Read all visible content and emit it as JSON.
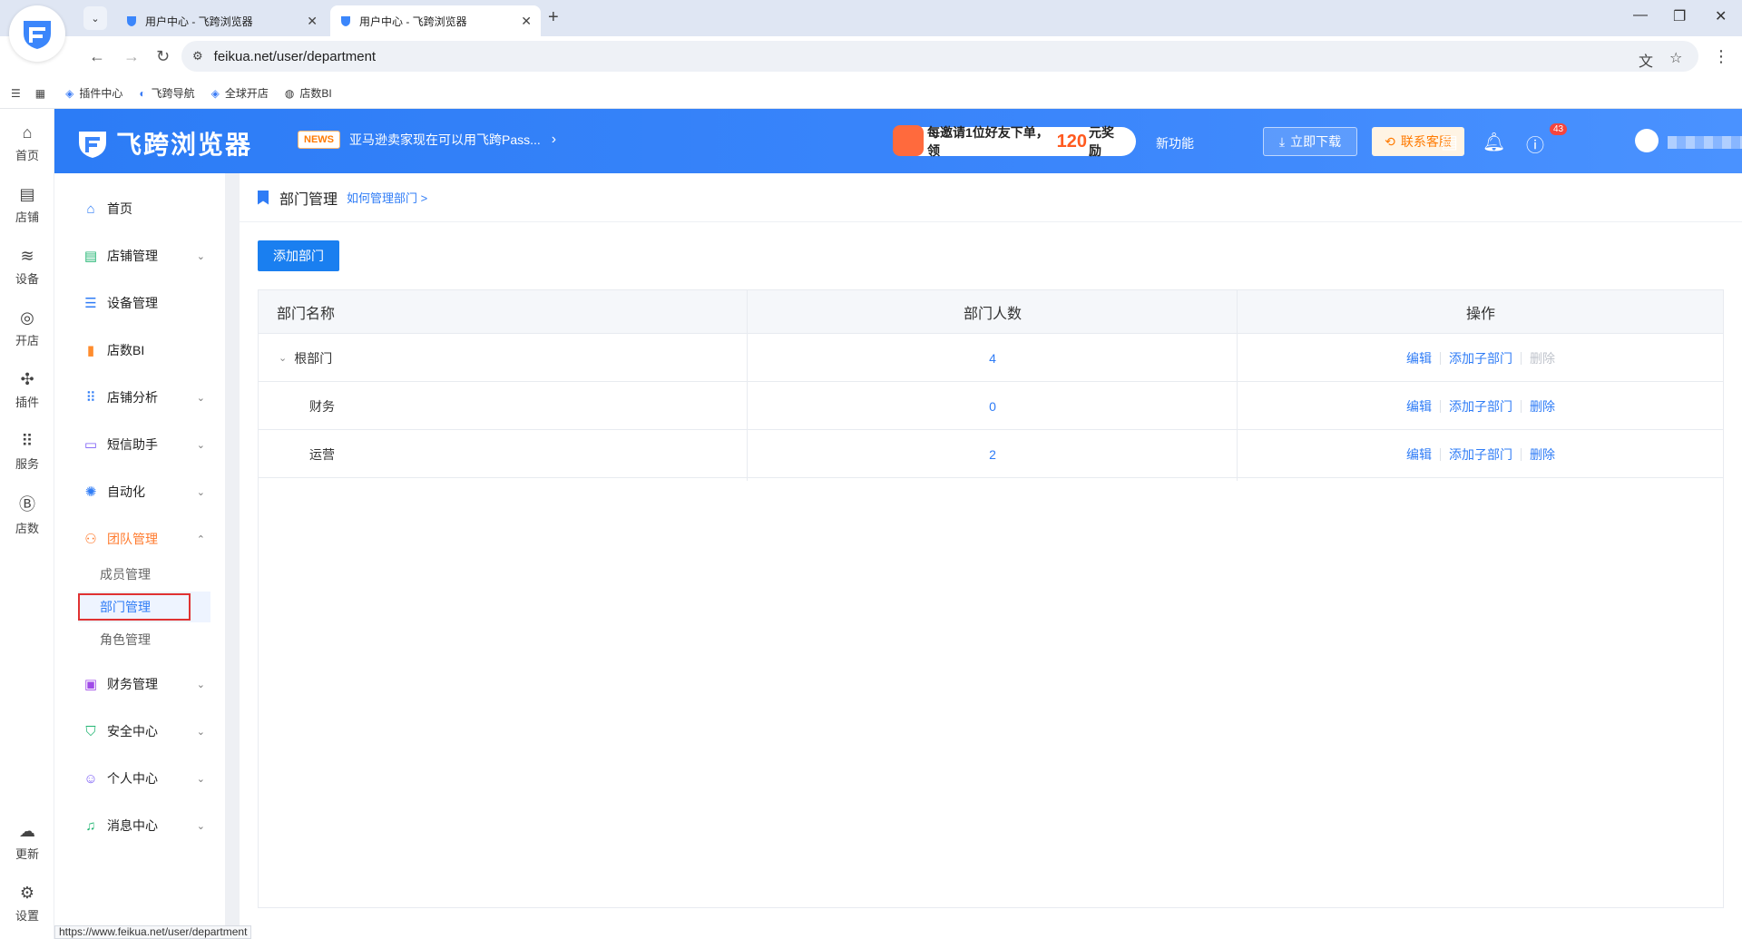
{
  "browser": {
    "tabs": [
      {
        "title": "用户中心 - 飞跨浏览器",
        "active": false
      },
      {
        "title": "用户中心 - 飞跨浏览器",
        "active": true
      }
    ],
    "url": "feikua.net/user/department",
    "bookmarks": [
      "插件中心",
      "飞跨导航",
      "全球开店",
      "店数BI"
    ],
    "status_url": "https://www.feikua.net/user/department"
  },
  "rail": {
    "items": [
      {
        "label": "首页",
        "icon": "home-icon"
      },
      {
        "label": "店铺",
        "icon": "store-icon"
      },
      {
        "label": "设备",
        "icon": "layers-icon"
      },
      {
        "label": "开店",
        "icon": "planet-icon"
      },
      {
        "label": "插件",
        "icon": "puzzle-icon"
      },
      {
        "label": "服务",
        "icon": "grid-icon"
      },
      {
        "label": "店数",
        "icon": "bi-icon"
      }
    ],
    "bottom": [
      {
        "label": "更新",
        "icon": "cloud-upload-icon"
      },
      {
        "label": "设置",
        "icon": "settings-icon"
      }
    ]
  },
  "header": {
    "brand": "飞跨浏览器",
    "news_badge": "NEWS",
    "news_text": "亚马逊卖家现在可以用飞跨Pass...",
    "invite_prefix": "每邀请1位好友下单，领",
    "invite_amount": "120",
    "invite_suffix": "元奖励",
    "new_feature": "新功能",
    "download": "立即下载",
    "service": "联系客服",
    "notifications": "43"
  },
  "menu": {
    "items": [
      {
        "label": "首页",
        "icon": "home-icon",
        "caret": ""
      },
      {
        "label": "店铺管理",
        "icon": "store-icon",
        "caret": "⌄"
      },
      {
        "label": "设备管理",
        "icon": "server-icon",
        "caret": ""
      },
      {
        "label": "店数BI",
        "icon": "bar-chart-icon",
        "caret": ""
      },
      {
        "label": "店铺分析",
        "icon": "grid-icon",
        "caret": "⌄"
      },
      {
        "label": "短信助手",
        "icon": "message-icon",
        "caret": "⌄"
      },
      {
        "label": "自动化",
        "icon": "gear-icon",
        "caret": "⌄"
      },
      {
        "label": "团队管理",
        "icon": "team-icon",
        "caret": "⌃"
      },
      {
        "label": "财务管理",
        "icon": "wallet-icon",
        "caret": "⌄"
      },
      {
        "label": "安全中心",
        "icon": "shield-icon",
        "caret": "⌄"
      },
      {
        "label": "个人中心",
        "icon": "user-icon",
        "caret": "⌄"
      },
      {
        "label": "消息中心",
        "icon": "bell-icon",
        "caret": "⌄"
      }
    ],
    "team_submenu": [
      "成员管理",
      "部门管理",
      "角色管理"
    ]
  },
  "page": {
    "title": "部门管理",
    "help_link": "如何管理部门 >",
    "add_button": "添加部门",
    "table": {
      "headers": [
        "部门名称",
        "部门人数",
        "操作"
      ],
      "rows": [
        {
          "name": "根部门",
          "count": "4",
          "ops": [
            "编辑",
            "添加子部门",
            "删除"
          ],
          "delete_disabled": true
        },
        {
          "name": "财务",
          "count": "0",
          "ops": [
            "编辑",
            "添加子部门",
            "删除"
          ],
          "delete_disabled": false
        },
        {
          "name": "运营",
          "count": "2",
          "ops": [
            "编辑",
            "添加子部门",
            "删除"
          ],
          "delete_disabled": false
        }
      ]
    }
  },
  "colors": {
    "primary": "#2f7cf6",
    "header_blue": "#3b86fb",
    "accent_orange": "#ff7a2d",
    "highlight_red": "#e03232"
  }
}
